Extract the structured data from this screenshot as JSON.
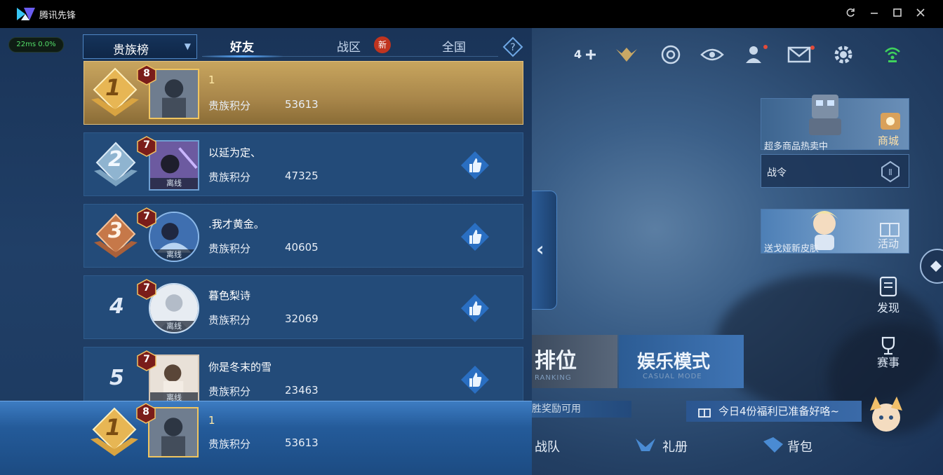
{
  "window": {
    "title": "腾讯先锋",
    "buttons": [
      "refresh-icon",
      "minimize-icon",
      "maximize-icon",
      "close-icon"
    ]
  },
  "status": {
    "ping": "22ms  0.0%"
  },
  "leaderboard": {
    "dropdown_label": "贵族榜",
    "tabs": [
      {
        "label": "好友",
        "active": true
      },
      {
        "label": "战区",
        "active": false,
        "badge": "新"
      },
      {
        "label": "全国",
        "active": false
      }
    ],
    "rows": [
      {
        "rank": "1",
        "level": "8",
        "name": "1",
        "score_label": "贵族积分",
        "score": "53613",
        "offline": "",
        "highlight": true
      },
      {
        "rank": "2",
        "level": "7",
        "name": "以延为定、",
        "score_label": "贵族积分",
        "score": "47325",
        "offline": "离线"
      },
      {
        "rank": "3",
        "level": "7",
        "name": ".我才黄金。",
        "score_label": "贵族积分",
        "score": "40605",
        "offline": "离线"
      },
      {
        "rank": "4",
        "level": "7",
        "name": "暮色梨诗",
        "score_label": "贵族积分",
        "score": "32069",
        "offline": "离线"
      },
      {
        "rank": "5",
        "level": "7",
        "name": "你是冬末的雪",
        "score_label": "贵族积分",
        "score": "23463",
        "offline": "离线"
      }
    ],
    "self": {
      "rank": "1",
      "level": "8",
      "name": "1",
      "score_label": "贵族积分",
      "score": "53613"
    }
  },
  "hud": {
    "count": "4",
    "shop_caption": "超多商品热卖中",
    "shop_label": "商城",
    "battlepass_label": "战令",
    "event_caption": "送戈娅新皮肤",
    "event_label": "活动",
    "discover_label": "发现",
    "match_label": "赛事",
    "ranked_label": "排位",
    "ranked_sub": "RANKING",
    "casual_label": "娱乐模式",
    "casual_sub": "CASUAL MODE",
    "reward_strip": "胜奖励可用",
    "banner": "今日4份福利已准备好咯~",
    "bottom_menu": [
      "战队",
      "礼册",
      "背包"
    ]
  },
  "colors": {
    "accent": "#5aaaff",
    "gold": "#c8a55e",
    "badge_red": "#c0341f",
    "ping_green": "#54e06a"
  }
}
